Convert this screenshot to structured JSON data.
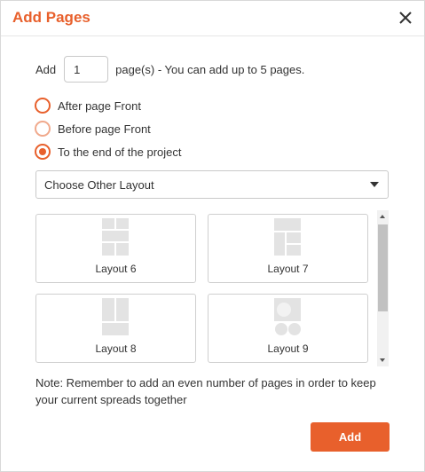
{
  "dialog": {
    "title": "Add Pages",
    "close_icon": "close-icon",
    "accent_color": "#e8602c"
  },
  "add_row": {
    "label": "Add",
    "pages_value": "1",
    "hint": "page(s) - You can add up to 5 pages."
  },
  "position_options": [
    {
      "label": "After page Front",
      "checked": false
    },
    {
      "label": "Before page Front",
      "checked": false
    },
    {
      "label": "To the end of the project",
      "checked": true
    }
  ],
  "layout_select": {
    "value": "Choose Other Layout"
  },
  "layouts": [
    {
      "name": "Layout 6"
    },
    {
      "name": "Layout 7"
    },
    {
      "name": "Layout 8"
    },
    {
      "name": "Layout 9"
    }
  ],
  "note": "Note: Remember to add an even number of pages in order to keep your current spreads together",
  "add_button": "Add"
}
